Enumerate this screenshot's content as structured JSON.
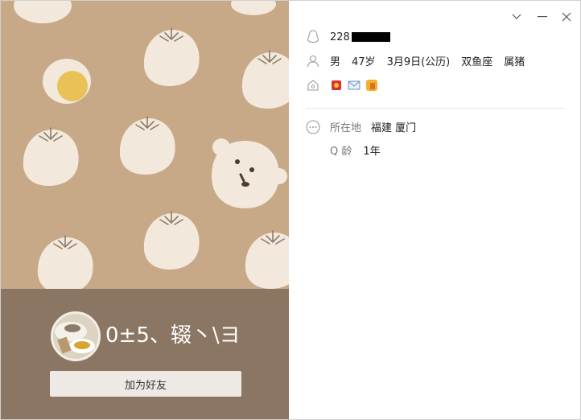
{
  "profile": {
    "qq_prefix": "228",
    "gender": "男",
    "age": "47岁",
    "birthday": "3月9日(公历)",
    "zodiac": "双鱼座",
    "chinese_zodiac": "属猪",
    "nickname": "0±5、辍丶\\ヨ",
    "add_friend_label": "加为好友"
  },
  "details": {
    "location_label": "所在地",
    "location_value": "福建 厦门",
    "qage_label": "Q 龄",
    "qage_value": "1年"
  },
  "icons": {
    "qq": "penguin-icon",
    "person": "person-icon",
    "badges": "badges-icon",
    "more": "more-icon",
    "collapse": "chevron-down-icon",
    "minimize": "minimize-icon",
    "close": "close-icon"
  },
  "colors": {
    "cover_bg": "#c7a887",
    "footer_bg": "#8b7664",
    "button_bg": "#ede9e5"
  }
}
